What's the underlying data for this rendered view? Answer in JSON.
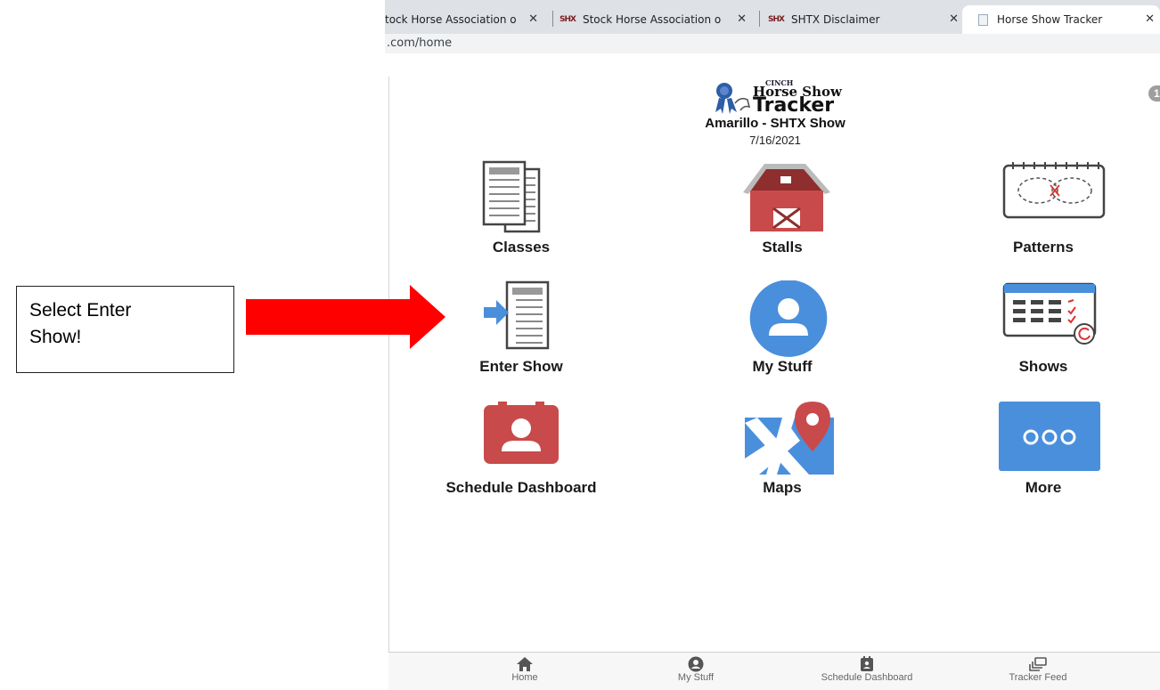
{
  "browser": {
    "tabs": [
      {
        "label": "tock Horse Association o",
        "favicon": ""
      },
      {
        "label": "Stock Horse Association o",
        "favicon": "SHX"
      },
      {
        "label": "SHTX Disclaimer",
        "favicon": "SHX"
      },
      {
        "label": "Horse Show Tracker",
        "favicon": "page-icon",
        "active": true
      }
    ],
    "address": ".com/home"
  },
  "app": {
    "logo": {
      "cinch": "CINCH",
      "line1": "Horse Show",
      "line2": "Tracker"
    },
    "badge": "1",
    "show_name": "Amarillo - SHTX Show",
    "show_date": "7/16/2021",
    "tiles": [
      {
        "label": "Classes",
        "icon": "classes-icon"
      },
      {
        "label": "Stalls",
        "icon": "barn-icon"
      },
      {
        "label": "Patterns",
        "icon": "pattern-icon"
      },
      {
        "label": "Enter Show",
        "icon": "enter-show-icon"
      },
      {
        "label": "My Stuff",
        "icon": "user-circle-icon"
      },
      {
        "label": "Shows",
        "icon": "calendar-icon"
      },
      {
        "label": "Schedule Dashboard",
        "icon": "schedule-badge-icon"
      },
      {
        "label": "Maps",
        "icon": "map-pin-icon"
      },
      {
        "label": "More",
        "icon": "more-dots-icon"
      }
    ],
    "colors": {
      "red": "#c94a4a",
      "blue": "#4a8fdc",
      "dark": "#444444"
    }
  },
  "bottom_nav": [
    {
      "label": "Home",
      "icon": "home-icon"
    },
    {
      "label": "My Stuff",
      "icon": "user-icon"
    },
    {
      "label": "Schedule Dashboard",
      "icon": "clipboard-icon"
    },
    {
      "label": "Tracker Feed",
      "icon": "feed-icon"
    }
  ],
  "callout": {
    "line1": "Select Enter",
    "line2": "Show!",
    "arrow_color": "#ff0000"
  }
}
